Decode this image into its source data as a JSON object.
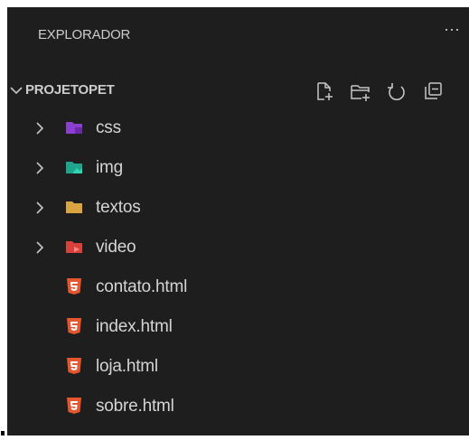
{
  "explorer": {
    "title": "EXPLORADOR",
    "more_label": "···"
  },
  "project": {
    "name": "PROJETOPET",
    "actions": [
      {
        "name": "new-file-icon"
      },
      {
        "name": "new-folder-icon"
      },
      {
        "name": "refresh-icon"
      },
      {
        "name": "collapse-all-icon"
      }
    ]
  },
  "tree": {
    "folders": [
      {
        "label": "css",
        "icon": "css-folder-icon",
        "color": "#8a3fd1"
      },
      {
        "label": "img",
        "icon": "image-folder-icon",
        "color": "#1fa58c"
      },
      {
        "label": "textos",
        "icon": "folder-icon",
        "color": "#d9a441"
      },
      {
        "label": "video",
        "icon": "video-folder-icon",
        "color": "#d9413c"
      }
    ],
    "files": [
      {
        "label": "contato.html",
        "icon": "html5-icon",
        "color": "#e4572e"
      },
      {
        "label": "index.html",
        "icon": "html5-icon",
        "color": "#e4572e"
      },
      {
        "label": "loja.html",
        "icon": "html5-icon",
        "color": "#e4572e"
      },
      {
        "label": "sobre.html",
        "icon": "html5-icon",
        "color": "#e4572e"
      }
    ]
  },
  "colors": {
    "background": "#1e1e1e",
    "text": "#cccccc"
  }
}
